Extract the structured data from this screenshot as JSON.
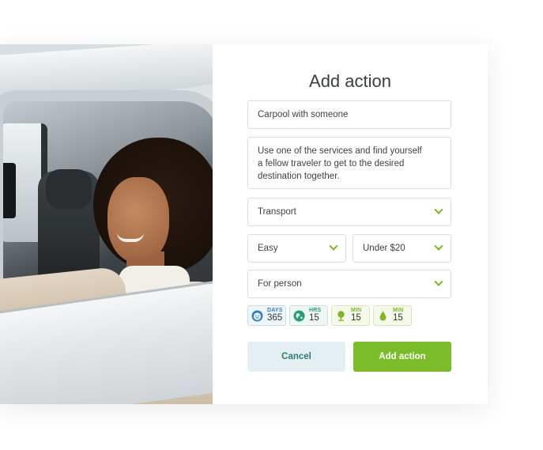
{
  "dialog": {
    "title": "Add action",
    "name_value": "Carpool with someone",
    "description_value": "Use one of the services and find yourself\na fellow traveler to get to the desired\ndestination together.",
    "category_value": "Transport",
    "difficulty_value": "Easy",
    "cost_value": "Under $20",
    "audience_value": "For person",
    "badges": [
      {
        "unit": "DAYS",
        "value": "365",
        "icon": "face-icon",
        "color": "#2f7fc1"
      },
      {
        "unit": "HRS",
        "value": "15",
        "icon": "globe-icon",
        "color": "#2b9a78"
      },
      {
        "unit": "MIN",
        "value": "15",
        "icon": "tree-icon",
        "color": "#7fb52a"
      },
      {
        "unit": "MIN",
        "value": "15",
        "icon": "drop-icon",
        "color": "#7fb52a"
      }
    ],
    "cancel_label": "Cancel",
    "add_label": "Add action"
  },
  "colors": {
    "accent": "#7cbb2a",
    "cancel_bg": "#e3eff0",
    "cancel_text": "#2f7a76"
  }
}
